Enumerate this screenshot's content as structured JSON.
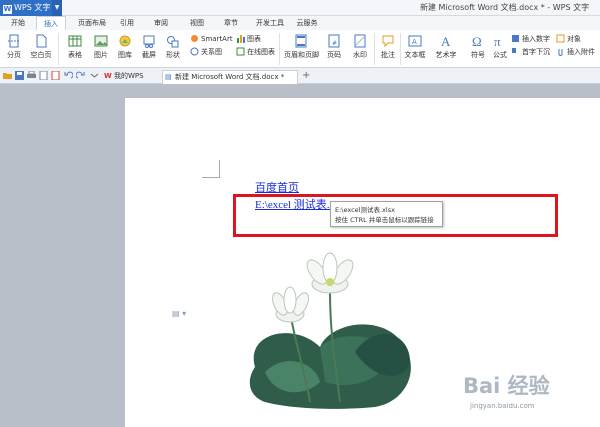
{
  "app": {
    "name": "WPS 文字",
    "logo_letter": "W",
    "window_title": "新建 Microsoft Word 文档.docx * - WPS 文字"
  },
  "menu_tabs": [
    "开始",
    "插入",
    "页面布局",
    "引用",
    "审阅",
    "视图",
    "章节",
    "开发工具",
    "云服务"
  ],
  "active_menu_tab": "插入",
  "ribbon": {
    "page_break": "分页",
    "blank_page": "空白页",
    "table": "表格",
    "picture": "图片",
    "gallery": "图库",
    "screenshot": "截屏",
    "shapes": "形状",
    "smartart": "SmartArt",
    "chart": "图表",
    "relation": "关系图",
    "online_chart": "在线图表",
    "header_footer": "页眉和页脚",
    "page_number": "页码",
    "watermark": "水印",
    "comment": "批注",
    "textbox": "文本框",
    "wordart": "艺术字",
    "symbol": "符号",
    "formula": "公式",
    "insert_number": "插入数字",
    "object": "对象",
    "drop_cap": "首字下沉",
    "insert_attachment": "插入附件"
  },
  "doc_tabs": {
    "my_wps": "我的WPS",
    "active_doc": "新建 Microsoft Word 文档.docx *",
    "add": "+"
  },
  "document": {
    "link1": "百度首页",
    "link2": "E:\\excel 测试表.xlsx"
  },
  "tooltip": {
    "line1": "E:\\excel测试表.xlsx",
    "line2": "按住 CTRL 并单击鼠标以跟踪链接"
  },
  "watermark": {
    "text": "Bai 经验",
    "url": "jingyan.baidu.com"
  },
  "colors": {
    "accent": "#2f6fc6",
    "link": "#1a2bd6",
    "highlight_box": "#e0141e"
  }
}
